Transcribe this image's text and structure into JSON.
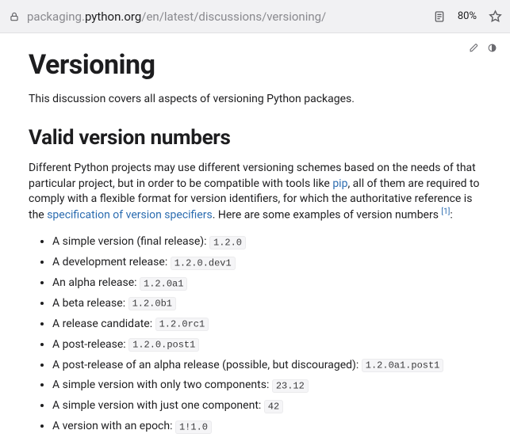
{
  "address": {
    "url_pre": "packaging.",
    "url_strong": "python.org",
    "url_post": "/en/latest/discussions/versioning/",
    "zoom": "80%"
  },
  "page": {
    "title": "Versioning",
    "intro": "This discussion covers all aspects of versioning Python packages.",
    "section_heading": "Valid version numbers",
    "section_para_parts": {
      "p1": "Different Python projects may use different versioning schemes based on the needs of that particular project, but in order to be compatible with tools like ",
      "link1": "pip",
      "p2": ", all of them are required to comply with a flexible format for version identifiers, for which the authoritative reference is the ",
      "link2": "specification of version specifiers",
      "p3": ". Here are some examples of version numbers ",
      "ref": "[1]",
      "p4": ":"
    },
    "links": {
      "pip": "pip",
      "spec": "specification of version specifiers"
    },
    "ref_label": "[1]",
    "items": [
      {
        "label": "A simple version (final release): ",
        "code": "1.2.0"
      },
      {
        "label": "A development release: ",
        "code": "1.2.0.dev1"
      },
      {
        "label": "An alpha release: ",
        "code": "1.2.0a1"
      },
      {
        "label": "A beta release: ",
        "code": "1.2.0b1"
      },
      {
        "label": "A release candidate: ",
        "code": "1.2.0rc1"
      },
      {
        "label": "A post-release: ",
        "code": "1.2.0.post1"
      },
      {
        "label": "A post-release of an alpha release (possible, but discouraged): ",
        "code": "1.2.0a1.post1"
      },
      {
        "label": "A simple version with only two components: ",
        "code": "23.12"
      },
      {
        "label": "A simple version with just one component: ",
        "code": "42"
      },
      {
        "label": "A version with an epoch: ",
        "code": "1!1.0"
      }
    ]
  },
  "icons": {
    "lock": "lock-icon",
    "reader": "reader-mode-icon",
    "star": "bookmark-star-icon",
    "edit": "edit-icon",
    "theme": "theme-toggle-icon"
  }
}
